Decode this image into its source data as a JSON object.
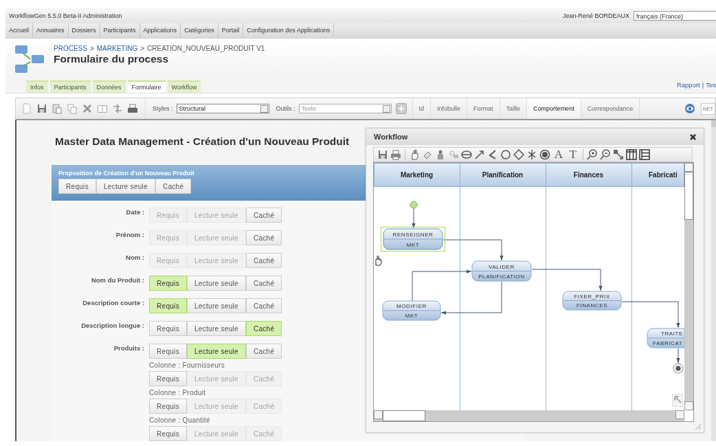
{
  "window": {
    "title": "WorkflowGen 5.5.0 Beta-II Administration"
  },
  "user": {
    "name": "Jean-René BORDEAUX",
    "language": "français (France)"
  },
  "menu": [
    "Accueil",
    "Annuaires",
    "Dossiers",
    "Participants",
    "Applications",
    "Catégories",
    "Portail",
    "Configuration des Applications"
  ],
  "breadcrumb": [
    {
      "label": "PROCESS",
      "link": true,
      "separator": ">"
    },
    {
      "label": "MARKETING",
      "link": true,
      "separator": ">"
    },
    {
      "label": "CREATION_NOUVEAU_PRODUIT V1",
      "link": false
    }
  ],
  "page_title": "Formulaire du process",
  "tabs": [
    {
      "label": "Infos",
      "selected": false
    },
    {
      "label": "Participants",
      "selected": false
    },
    {
      "label": "Données",
      "selected": false
    },
    {
      "label": "Formulaire",
      "selected": true
    },
    {
      "label": "Workflow",
      "selected": false
    }
  ],
  "header_links": {
    "items": [
      "Rapport",
      "Tes"
    ],
    "separator": "|"
  },
  "toolbar": {
    "styles_label": "Styles :",
    "styles_value": "Structural",
    "tools_label": "Outils :",
    "tools_select": {
      "value": "Texte",
      "disabled": true
    },
    "property_tabs": [
      {
        "label": "Id",
        "selected": false
      },
      {
        "label": "Infobulle",
        "selected": false
      },
      {
        "label": "Format",
        "selected": false
      },
      {
        "label": "Taille",
        "selected": false
      },
      {
        "label": "Comportement",
        "selected": true
      },
      {
        "label": "Correspondance",
        "selected": false
      }
    ],
    "net_label": "NET"
  },
  "form": {
    "title": "Master Data Management - Création d'un Nouveau Produit",
    "section": {
      "title": "Proposition de Création d'un Nouveau Produit",
      "buttons": [
        {
          "label": "Requis",
          "selected": false,
          "disabled": false
        },
        {
          "label": "Lecture seule",
          "selected": false,
          "disabled": false
        },
        {
          "label": "Caché",
          "selected": false,
          "disabled": false
        }
      ]
    },
    "fields": [
      {
        "label": "Date :",
        "buttons": [
          {
            "label": "Requis",
            "selected": false,
            "disabled": true
          },
          {
            "label": "Lecture seule",
            "selected": false,
            "disabled": true
          },
          {
            "label": "Caché",
            "selected": false,
            "disabled": false
          }
        ]
      },
      {
        "label": "Prénom :",
        "buttons": [
          {
            "label": "Requis",
            "selected": false,
            "disabled": true
          },
          {
            "label": "Lecture seule",
            "selected": false,
            "disabled": true
          },
          {
            "label": "Caché",
            "selected": false,
            "disabled": false
          }
        ]
      },
      {
        "label": "Nom :",
        "buttons": [
          {
            "label": "Requis",
            "selected": false,
            "disabled": true
          },
          {
            "label": "Lecture seule",
            "selected": false,
            "disabled": true
          },
          {
            "label": "Caché",
            "selected": false,
            "disabled": false
          }
        ]
      },
      {
        "label": "Nom du Produit :",
        "buttons": [
          {
            "label": "Requis",
            "selected": true,
            "disabled": false
          },
          {
            "label": "Lecture seule",
            "selected": false,
            "disabled": false
          },
          {
            "label": "Caché",
            "selected": false,
            "disabled": false
          }
        ]
      },
      {
        "label": "Description courte :",
        "buttons": [
          {
            "label": "Requis",
            "selected": true,
            "disabled": false
          },
          {
            "label": "Lecture seule",
            "selected": false,
            "disabled": false
          },
          {
            "label": "Caché",
            "selected": false,
            "disabled": false
          }
        ]
      },
      {
        "label": "Description longue :",
        "buttons": [
          {
            "label": "Requis",
            "selected": false,
            "disabled": false
          },
          {
            "label": "Lecture seule",
            "selected": false,
            "disabled": false
          },
          {
            "label": "Caché",
            "selected": true,
            "disabled": false
          }
        ]
      },
      {
        "label": "Produits :",
        "buttons": [
          {
            "label": "Requis",
            "selected": false,
            "disabled": false
          },
          {
            "label": "Lecture seule",
            "selected": true,
            "disabled": false
          },
          {
            "label": "Caché",
            "selected": false,
            "disabled": false
          }
        ],
        "columns": [
          {
            "label": "Colonne : Fournisseurs",
            "buttons": [
              {
                "label": "Requis",
                "selected": false,
                "disabled": false
              },
              {
                "label": "Lecture seule",
                "selected": false,
                "disabled": true
              },
              {
                "label": "Caché",
                "selected": false,
                "disabled": true
              }
            ]
          },
          {
            "label": "Colonne : Produit",
            "buttons": [
              {
                "label": "Requis",
                "selected": false,
                "disabled": false
              },
              {
                "label": "Lecture seule",
                "selected": false,
                "disabled": true
              },
              {
                "label": "Caché",
                "selected": false,
                "disabled": true
              }
            ]
          },
          {
            "label": "Colonne : Quantité",
            "buttons": [
              {
                "label": "Requis",
                "selected": false,
                "disabled": false
              },
              {
                "label": "Lecture seule",
                "selected": false,
                "disabled": true
              },
              {
                "label": "Caché",
                "selected": false,
                "disabled": true
              }
            ]
          }
        ]
      }
    ]
  },
  "workflow_window": {
    "title": "Workflow",
    "text_tools": [
      "A",
      "T"
    ],
    "lanes": [
      "Marketing",
      "Planification",
      "Finances",
      "Fabricati"
    ],
    "nodes": [
      {
        "name": "RENSEIGNER",
        "participant": "MKT",
        "selected": true
      },
      {
        "name": "VALIDER",
        "participant": "PLANIFICATION",
        "selected": false
      },
      {
        "name": "MODIFIER",
        "participant": "MKT",
        "selected": false
      },
      {
        "name": "FIXER_PRIX",
        "participant": "FINANCES",
        "selected": false
      },
      {
        "name": "TRAITE",
        "participant": "FABRICAT",
        "selected": false
      }
    ]
  }
}
